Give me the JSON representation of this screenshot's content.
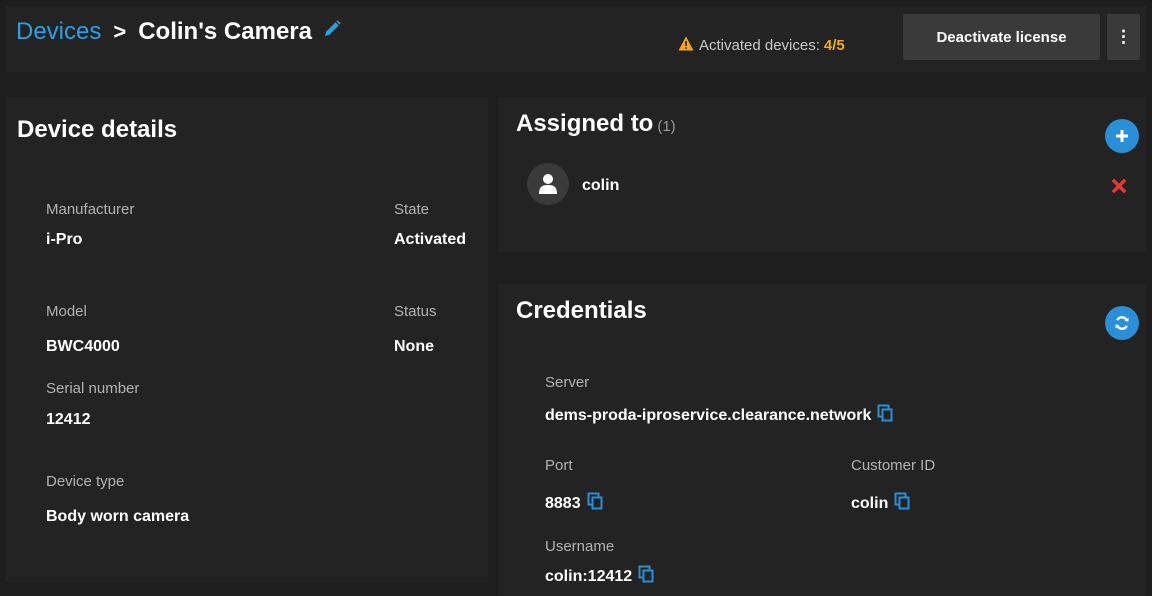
{
  "header": {
    "breadcrumb_root": "Devices",
    "breadcrumb_separator": ">",
    "device_name": "Colin's Camera",
    "activated_label": "Activated devices:",
    "activated_count": "4/5",
    "deactivate_label": "Deactivate license",
    "more_label": "⋮"
  },
  "details": {
    "title": "Device details",
    "manufacturer_label": "Manufacturer",
    "manufacturer_value": "i-Pro",
    "state_label": "State",
    "state_value": "Activated",
    "model_label": "Model",
    "model_value": "BWC4000",
    "status_label": "Status",
    "status_value": "None",
    "serial_label": "Serial number",
    "serial_value": "12412",
    "type_label": "Device type",
    "type_value": "Body worn camera"
  },
  "assigned": {
    "title": "Assigned to",
    "count": "(1)",
    "users": [
      {
        "name": "colin"
      }
    ]
  },
  "credentials": {
    "title": "Credentials",
    "server_label": "Server",
    "server_value": "dems-proda-iproservice.clearance.network",
    "port_label": "Port",
    "port_value": "8883",
    "customer_label": "Customer ID",
    "customer_value": "colin",
    "username_label": "Username",
    "username_value": "colin:12412"
  },
  "colors": {
    "accent": "#2a8fd6",
    "link": "#2aa0e6",
    "warning": "#f5a623",
    "danger": "#e53935",
    "panel": "#232323",
    "background": "#1e1e1e"
  },
  "icons": {
    "edit": "pencil-icon",
    "warning": "warning-icon",
    "add": "plus-icon",
    "user": "user-icon",
    "remove": "close-icon",
    "refresh": "refresh-icon",
    "copy": "copy-icon"
  }
}
